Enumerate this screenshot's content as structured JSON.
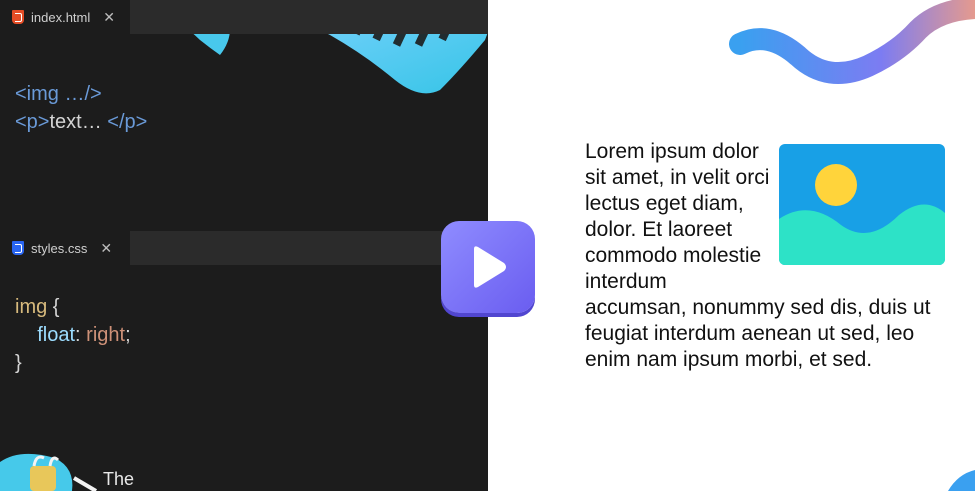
{
  "editor": {
    "html_tab": {
      "filename": "index.html",
      "icon": "html5-file-icon"
    },
    "css_tab": {
      "filename": "styles.css",
      "icon": "css3-file-icon"
    },
    "html_code": {
      "line1_open": "<img …/>",
      "line2_tag_open": "<p>",
      "line2_text": "text… ",
      "line2_tag_close": "</p>"
    },
    "css_code": {
      "selector": "img",
      "open_brace": " {",
      "property": "float",
      "colon": ": ",
      "value": "right",
      "semicolon": ";",
      "close_brace": "}"
    },
    "close_glyph": "✕"
  },
  "preview": {
    "floated_text": "Lorem ipsum dolor sit amet, in velit orci lectus eget diam, dolor.",
    "following_text": "Et laoreet commodo molestie interdum accumsan, nonummy sed dis, duis ut feugiat interdum aenean ut sed, leo enim nam ipsum morbi, et sed.",
    "image_icon": "landscape-image-icon"
  },
  "overlay": {
    "play_icon": "play-icon",
    "caption": "The"
  },
  "colors": {
    "editor_bg": "#1c1c1c",
    "tag_color": "#6a9ad8",
    "selector_color": "#d7ba7d",
    "play_button": "#7b74f7",
    "accent_cyan": "#3ed6e8"
  }
}
